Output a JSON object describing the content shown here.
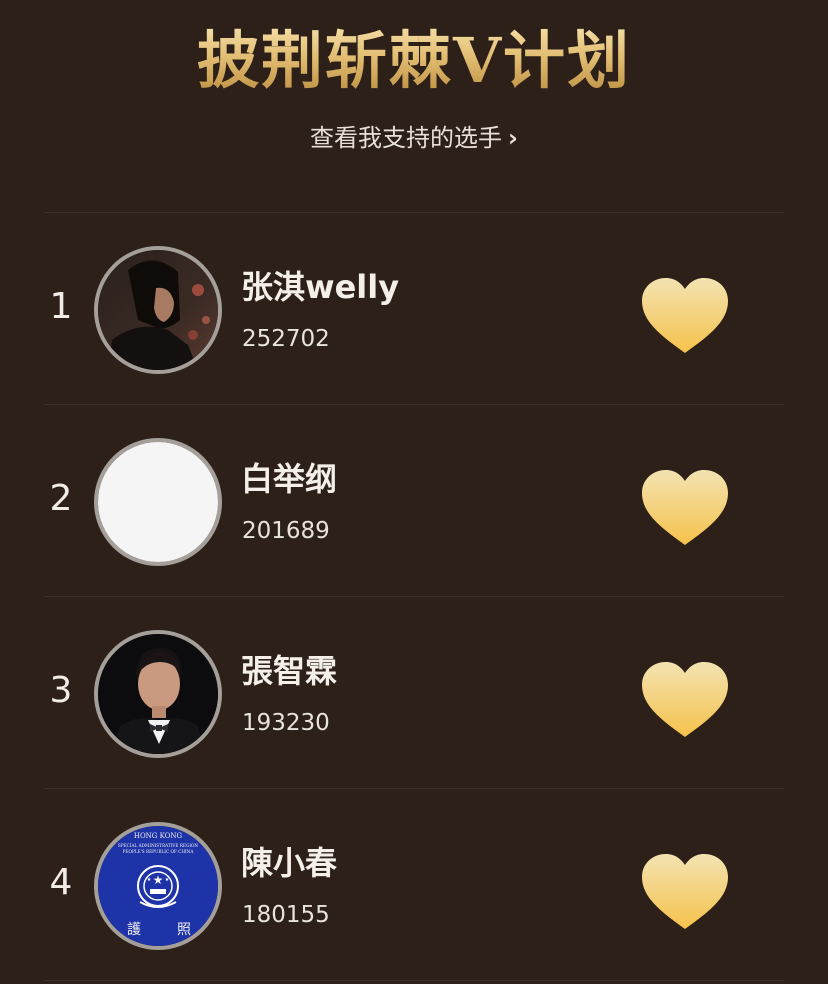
{
  "header": {
    "title": "披荆斩棘V计划",
    "subtitle_link": "查看我支持的选手",
    "subtitle_icon": "chevron-right-icon"
  },
  "colors": {
    "background": "#2c2019",
    "title_gold": "#e2bd72",
    "heart_top": "#f3e3b1",
    "heart_bottom": "#f6c24c",
    "divider": "#3d2f26"
  },
  "contestants": [
    {
      "rank": "1",
      "name": "张淇welly",
      "votes": "252702",
      "avatar": "photo-man-long-hair",
      "action_icon": "heart-icon"
    },
    {
      "rank": "2",
      "name": "白举纲",
      "votes": "201689",
      "avatar": "blank-white",
      "action_icon": "heart-icon"
    },
    {
      "rank": "3",
      "name": "張智霖",
      "votes": "193230",
      "avatar": "photo-man-bowtie",
      "action_icon": "heart-icon"
    },
    {
      "rank": "4",
      "name": "陳小春",
      "votes": "180155",
      "avatar": "hk-passport-cover",
      "action_icon": "heart-icon"
    }
  ],
  "passport_avatar_text": {
    "line1": "HONG KONG",
    "line2": "SPECIAL ADMINISTRATIVE REGION",
    "line3": "PEOPLE'S REPUBLIC OF CHINA",
    "char_left": "護",
    "char_right": "照"
  }
}
